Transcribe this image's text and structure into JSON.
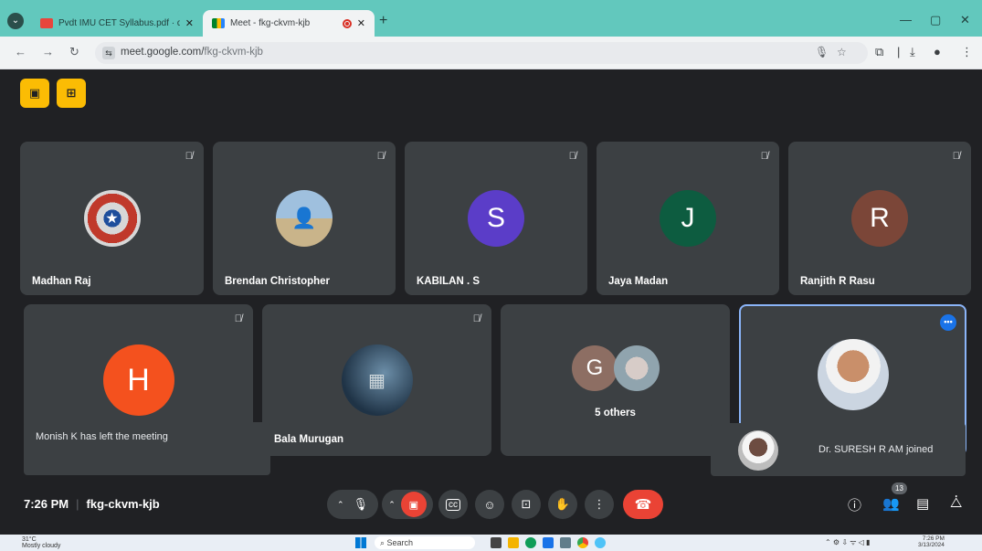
{
  "browser": {
    "tabs": [
      {
        "title": "Pvdt IMU CET Syllabus.pdf · dmit..."
      },
      {
        "title": "Meet - fkg-ckvm-kjb"
      }
    ],
    "url_domain": "meet.google.com/",
    "url_path": "fkg-ckvm-kjb"
  },
  "meeting": {
    "time": "7:26 PM",
    "code": "fkg-ckvm-kjb",
    "participants_count": "13"
  },
  "tiles_row1": [
    {
      "name": "Madhan Raj",
      "avatar": "captain-america-shield",
      "color": "#c0392b"
    },
    {
      "name": "Brendan Christopher",
      "avatar": "photo",
      "color": "#8aa6c1"
    },
    {
      "name": "KABILAN . S",
      "initial": "S",
      "color": "#5b3dc8"
    },
    {
      "name": "Jaya Madan",
      "initial": "J",
      "color": "#0d5c40"
    },
    {
      "name": "Ranjith R Rasu",
      "initial": "R",
      "color": "#7b4638"
    }
  ],
  "tiles_row2": [
    {
      "name": "Monish K",
      "initial": "H",
      "color": "#f4511e"
    },
    {
      "name": "Bala Murugan",
      "avatar": "car-photo",
      "color": "#1f3346"
    },
    {
      "name": "5 others",
      "initial": "G",
      "color": "#8d6e63"
    },
    {
      "name": "Dr. SURESH R AM",
      "avatar": "photo",
      "color": "#e0e0e0"
    }
  ],
  "toasts": {
    "left": "Monish K has left the meeting",
    "right": "Dr. SURESH R AM joined"
  },
  "taskbar": {
    "weather": "31°C",
    "weather_desc": "Mostly cloudy",
    "search": "Search",
    "clock_time": "7:26 PM",
    "clock_date": "3/13/2024"
  }
}
